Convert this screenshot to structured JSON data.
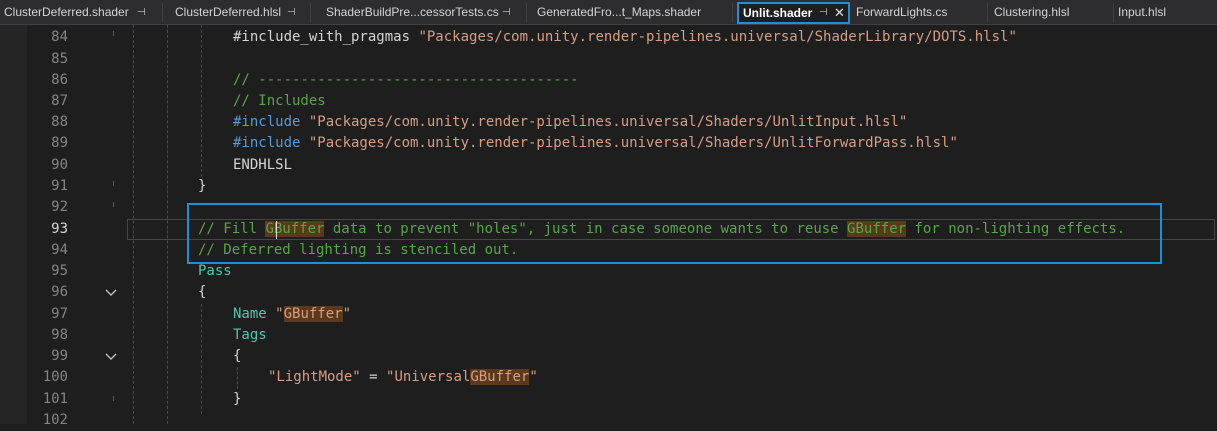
{
  "tabs": [
    {
      "label": "ClusterDeferred.shader",
      "pinned": true
    },
    {
      "label": "ClusterDeferred.hlsl",
      "pinned": true
    },
    {
      "label": "ShaderBuildPre...cessorTests.cs",
      "pinned": true
    },
    {
      "label": "GeneratedFro...t_Maps.shader",
      "pinned": true
    },
    {
      "label": "Unlit.shader",
      "pinned": true,
      "active": true
    },
    {
      "label": "ForwardLights.cs",
      "pinned": false
    },
    {
      "label": "Clustering.hlsl",
      "pinned": false
    },
    {
      "label": "Input.hlsl",
      "pinned": false
    }
  ],
  "pin_glyph": "⊣",
  "close_glyph": "✕",
  "current_line": 93,
  "line_numbers": [
    "84",
    "85",
    "86",
    "87",
    "88",
    "89",
    "90",
    "91",
    "92",
    "93",
    "94",
    "95",
    "96",
    "97",
    "98",
    "99",
    "100",
    "101",
    "102"
  ],
  "folds": {
    "96": "chevron-down",
    "99": "chevron-down"
  },
  "code": {
    "l84_a": "#include_with_pragmas ",
    "l84_b": "\"Packages/com.unity.render-pipelines.universal/ShaderLibrary/DOTS.hlsl\"",
    "l86": "// --------------------------------------",
    "l87": "// Includes",
    "l88_a": "#include ",
    "l88_b": "\"Packages/com.unity.render-pipelines.universal/Shaders/UnlitInput.hlsl\"",
    "l89_a": "#include ",
    "l89_b": "\"Packages/com.unity.render-pipelines.universal/Shaders/UnlitForwardPass.hlsl\"",
    "l90": "ENDHLSL",
    "l91": "}",
    "l93_a": "// Fill ",
    "l93_b": "GBuffer",
    "l93_c": " data to prevent \"holes\", just in case someone wants to reuse ",
    "l93_d": "GBuffer",
    "l93_e": " for non-lighting effects.",
    "l94": "// Deferred lighting is stenciled out.",
    "l95": "Pass",
    "l96": "{",
    "l97_a": "Name ",
    "l97_b": "\"",
    "l97_c": "GBuffer",
    "l97_d": "\"",
    "l98": "Tags",
    "l99": "{",
    "l100_a": "\"LightMode\"",
    "l100_b": " = ",
    "l100_c": "\"Universal",
    "l100_d": "GBuffer",
    "l100_e": "\"",
    "l101": "}"
  }
}
